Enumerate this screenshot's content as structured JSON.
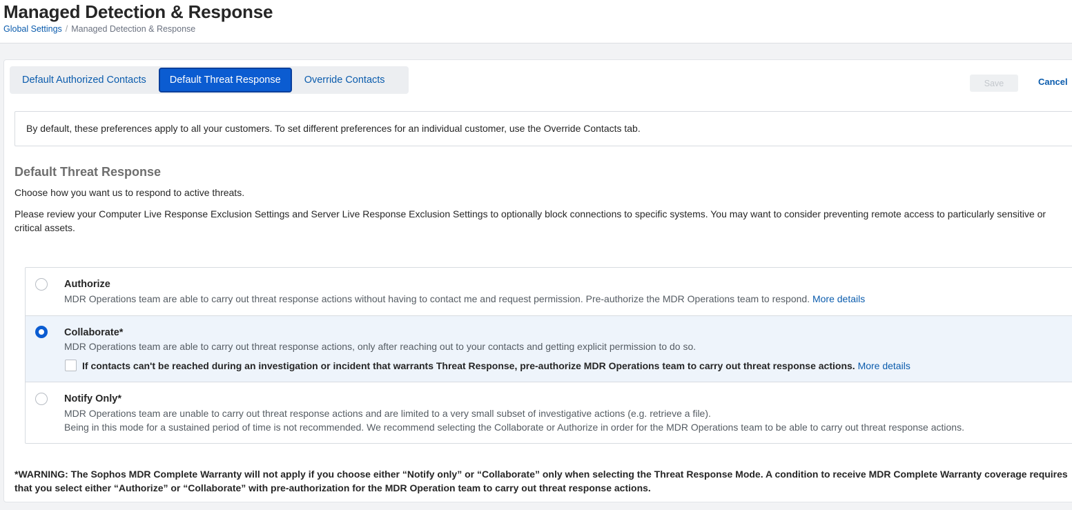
{
  "header": {
    "title": "Managed Detection & Response",
    "breadcrumb": {
      "parent": "Global Settings",
      "separator": "/",
      "current": "Managed Detection & Response"
    }
  },
  "tabs": [
    {
      "label": "Default Authorized Contacts",
      "active": false
    },
    {
      "label": "Default Threat Response",
      "active": true
    },
    {
      "label": "Override Contacts",
      "active": false
    }
  ],
  "actions": {
    "save_label": "Save",
    "save_disabled": true,
    "cancel_label": "Cancel"
  },
  "info": {
    "text": "By default, these preferences apply to all your customers. To set different preferences for an individual customer, use the Override Contacts tab."
  },
  "section": {
    "title": "Default Threat Response",
    "subtitle": "Choose how you want us to respond to active threats.",
    "review": "Please review your Computer Live Response Exclusion Settings and Server Live Response Exclusion Settings to optionally block connections to specific systems. You may want to consider preventing remote access to particularly sensitive or critical assets."
  },
  "options": [
    {
      "label": "Authorize",
      "selected": false,
      "desc": "MDR Operations team are able to carry out threat response actions without having to contact me and request permission. Pre-authorize the MDR Operations team to respond.",
      "link": "More details"
    },
    {
      "label": "Collaborate*",
      "selected": true,
      "desc": "MDR Operations team are able to carry out threat response actions, only after reaching out to your contacts and getting explicit permission to do so.",
      "checkbox": {
        "checked": false,
        "label": "If contacts can't be reached during an investigation or incident that warrants Threat Response, pre-authorize MDR Operations team to carry out threat response actions.",
        "link": "More details"
      }
    },
    {
      "label": "Notify Only*",
      "selected": false,
      "desc": "MDR Operations team are unable to carry out threat response actions and are limited to a very small subset of investigative actions (e.g. retrieve a file).",
      "desc2": "Being in this mode for a sustained period of time is not recommended. We recommend selecting the Collaborate or Authorize in order for the MDR Operations team to be able to carry out threat response actions."
    }
  ],
  "warning": "*WARNING: The Sophos MDR Complete Warranty will not apply if you choose either “Notify only” or “Collaborate” only when selecting the Threat Response Mode. A condition to receive MDR Complete Warranty coverage requires that you select either “Authorize” or “Collaborate” with pre-authorization for the MDR Operation team to carry out threat response actions.",
  "colors": {
    "accent": "#0b5cd1",
    "link": "#0b5cad",
    "selected_bg": "#eef4fb"
  }
}
